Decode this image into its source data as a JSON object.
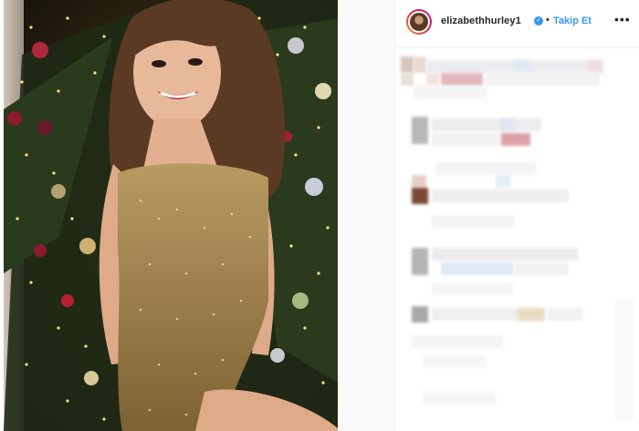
{
  "post": {
    "username": "elizabethhurley1",
    "follow_label": "Takip Et",
    "separator": "•",
    "more_label": "•••",
    "verified_icon": "verified-badge-icon",
    "accent_color": "#3897f0"
  }
}
